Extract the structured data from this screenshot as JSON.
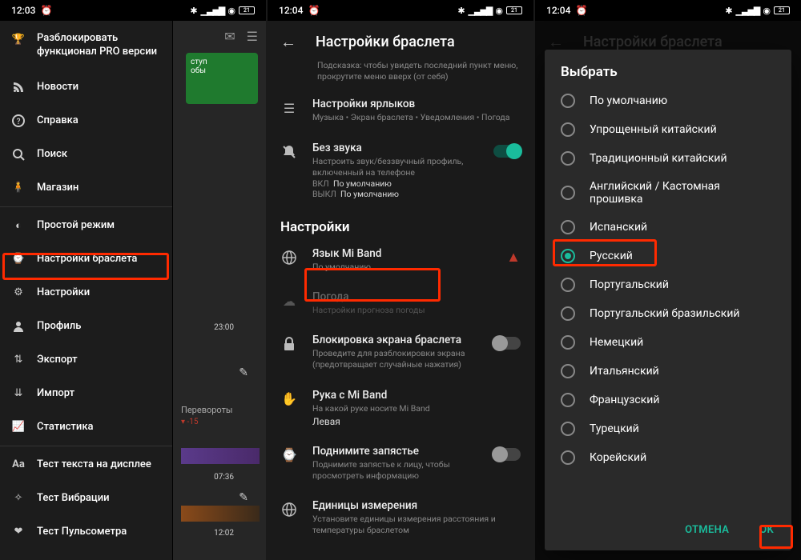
{
  "status": {
    "times": [
      "12:03",
      "12:04",
      "12:04"
    ],
    "battery": "21"
  },
  "pane1": {
    "unlock_pro": "Разблокировать функционал PRO версии",
    "items": [
      "Новости",
      "Справка",
      "Поиск",
      "Магазин",
      "Простой режим",
      "Настройки браслета",
      "Настройки",
      "Профиль",
      "Экспорт",
      "Импорт",
      "Статистика",
      "Тест текста на дисплее",
      "Тест Вибрации",
      "Тест Пульсометра"
    ],
    "bg": {
      "green_line1": "ступ",
      "green_line2": "обы",
      "time_top": "23:00",
      "flips_label": "Перевороты",
      "flips_delta": "▾ -15",
      "time1": "07:36",
      "time2": "12:02"
    }
  },
  "pane2": {
    "title": "Настройки браслета",
    "hint": "Подсказка: чтобы увидеть последний пункт меню, прокрутите меню вверх (от себя)",
    "rows": {
      "shortcuts_t": "Настройки ярлыков",
      "shortcuts_s": "Музыка • Экран браслета • Уведомления • Погода",
      "silent_t": "Без звука",
      "silent_s": "Настроить звук/беззвучный профиль, включенный на телефоне",
      "silent_on_l": "ВКЛ",
      "silent_on_v": "По умолчанию",
      "silent_off_l": "ВЫКЛ",
      "silent_off_v": "По умолчанию",
      "section": "Настройки",
      "lang_t": "Язык Mi Band",
      "lang_s": "По умолчанию",
      "weather_t": "Погода",
      "weather_s": "Настройки прогноза погоды",
      "lock_t": "Блокировка экрана браслета",
      "lock_s": "Проведите для разблокировки экрана (предотвращает случайные нажатия)",
      "hand_t": "Рука с Mi Band",
      "hand_s": "На какой руке носите Mi Band",
      "hand_v": "Левая",
      "lift_t": "Поднимите запястье",
      "lift_s": "Поднимите запястье к лицу, чтобы просмотреть информацию",
      "units_t": "Единицы измерения",
      "units_s": "Установите единицы измерения расстояния и температуры браслетом"
    }
  },
  "pane3": {
    "title": "Настройки браслета",
    "dlg_title": "Выбрать",
    "options": [
      "По умолчанию",
      "Упрощенный китайский",
      "Традиционный китайский",
      "Английский / Кастомная прошивка",
      "Испанский",
      "Русский",
      "Португальский",
      "Португальский бразильский",
      "Немецкий",
      "Итальянский",
      "Французский",
      "Турецкий",
      "Корейский"
    ],
    "selected_index": 5,
    "cancel": "ОТМЕНА",
    "ok": "OK"
  }
}
